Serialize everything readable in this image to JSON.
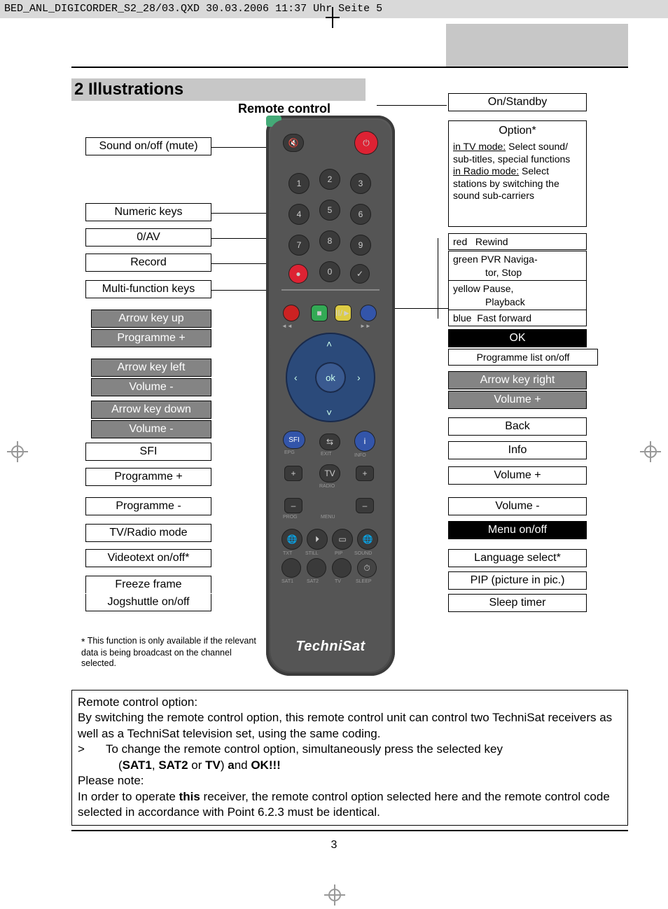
{
  "header": {
    "text": "BED_ANL_DIGICORDER_S2_28/03.QXD  30.03.2006  11:37 Uhr  Seite 5"
  },
  "heading": "2 Illustrations",
  "subheading": "Remote control",
  "left_boxes": {
    "mute": "Sound on/off (mute)",
    "numeric": "Numeric keys",
    "av": "0/AV",
    "record": "Record",
    "multifn": "Multi-function keys",
    "arrow_up": "Arrow key up",
    "prog_plus": "Programme +",
    "arrow_left": "Arrow key left",
    "vol_minus1": "Volume -",
    "arrow_down": "Arrow key down",
    "vol_minus2": "Volume -",
    "sfi": "SFI",
    "prog_plus2": "Programme +",
    "prog_minus": "Programme -",
    "tvradio": "TV/Radio mode",
    "videotext": "Videotext on/off*",
    "freeze": "Freeze frame",
    "jog": "Jogshuttle on/off"
  },
  "right_boxes": {
    "standby": "On/Standby",
    "option_title": "Option*",
    "option_tv_label": "in TV mode:",
    "option_tv_text": "Select sound/ sub-titles, special functions",
    "option_radio_label": "in Radio mode:",
    "option_radio_text": " Select stations by switching the sound sub-carriers",
    "red": "red   Rewind",
    "green_l1": "green PVR Naviga-",
    "green_l2": "tor, Stop",
    "yellow_l1": "yellow Pause,",
    "yellow_l2": "Playback",
    "blue": "blue  Fast forward",
    "ok": "OK",
    "proglist": "Programme list on/off",
    "arrow_right": "Arrow key right",
    "vol_plus1": "Volume +",
    "back": "Back",
    "info": "Info",
    "vol_plus2": "Volume +",
    "vol_minus": "Volume -",
    "menu": "Menu on/off",
    "language": "Language select*",
    "pip": "PIP (picture in pic.)",
    "sleep": "Sleep timer"
  },
  "remote_labels": {
    "ok": "ok",
    "sfi": "SFI",
    "epg": "EPG",
    "exit": "EXIT",
    "info_i": "i",
    "info": "INFO",
    "tv": "TV",
    "radio": "RADIO",
    "prog": "PROG",
    "menu": "MENU",
    "txt": "TXT",
    "still": "STILL",
    "pip": "PIP",
    "sound": "SOUND",
    "sat1": "SAT1",
    "sat2": "SAT2",
    "tv2": "TV",
    "sleep": "SLEEP",
    "n1": "1",
    "n2": "2",
    "n3": "3",
    "n4": "4",
    "n5": "5",
    "n6": "6",
    "n7": "7",
    "n8": "8",
    "n9": "9",
    "n0": "0",
    "plus": "+",
    "minus": "–",
    "rew": "◄◄",
    "ff": "►►",
    "pauseicon": "II/►",
    "stopicon": "■",
    "brand": "TechniSat"
  },
  "footnote": {
    "star": "*",
    "text": "This function is only available if the relevant data is being broadcast on the channel selected."
  },
  "note": {
    "l1": "Remote control option:",
    "l2": "By switching the remote control option, this remote control unit can control two TechniSat receivers as well as a TechniSat television set, using the same coding.",
    "chev": ">",
    "l3a": "To change the remote control option, simultaneously press the selected key",
    "l3b_pre": "(",
    "sat1": "SAT1",
    "comma1": ", ",
    "sat2": "SAT2",
    "or": " or ",
    "tv": "TV",
    "paren": ") ",
    "and_a": "a",
    "and_nd": "nd ",
    "ok": "OK!!!",
    "l4": "Please note:",
    "l5a": "In order to operate ",
    "l5_this": "this",
    "l5b": " receiver, the remote control option selected here and the remote control code selected in accordance with Point 6.2.3 must be identical."
  },
  "page_number": "3"
}
